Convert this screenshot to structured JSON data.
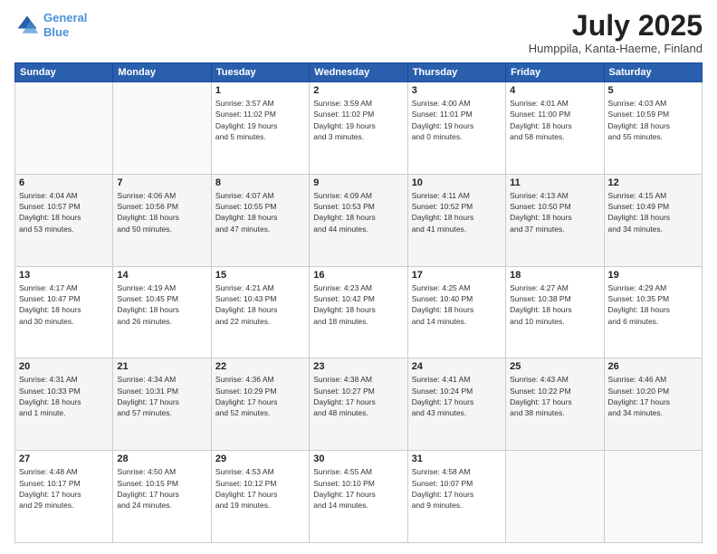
{
  "logo": {
    "line1": "General",
    "line2": "Blue"
  },
  "header": {
    "month": "July 2025",
    "location": "Humppila, Kanta-Haeme, Finland"
  },
  "weekdays": [
    "Sunday",
    "Monday",
    "Tuesday",
    "Wednesday",
    "Thursday",
    "Friday",
    "Saturday"
  ],
  "weeks": [
    [
      {
        "day": "",
        "info": ""
      },
      {
        "day": "",
        "info": ""
      },
      {
        "day": "1",
        "info": "Sunrise: 3:57 AM\nSunset: 11:02 PM\nDaylight: 19 hours\nand 5 minutes."
      },
      {
        "day": "2",
        "info": "Sunrise: 3:59 AM\nSunset: 11:02 PM\nDaylight: 19 hours\nand 3 minutes."
      },
      {
        "day": "3",
        "info": "Sunrise: 4:00 AM\nSunset: 11:01 PM\nDaylight: 19 hours\nand 0 minutes."
      },
      {
        "day": "4",
        "info": "Sunrise: 4:01 AM\nSunset: 11:00 PM\nDaylight: 18 hours\nand 58 minutes."
      },
      {
        "day": "5",
        "info": "Sunrise: 4:03 AM\nSunset: 10:59 PM\nDaylight: 18 hours\nand 55 minutes."
      }
    ],
    [
      {
        "day": "6",
        "info": "Sunrise: 4:04 AM\nSunset: 10:57 PM\nDaylight: 18 hours\nand 53 minutes."
      },
      {
        "day": "7",
        "info": "Sunrise: 4:06 AM\nSunset: 10:56 PM\nDaylight: 18 hours\nand 50 minutes."
      },
      {
        "day": "8",
        "info": "Sunrise: 4:07 AM\nSunset: 10:55 PM\nDaylight: 18 hours\nand 47 minutes."
      },
      {
        "day": "9",
        "info": "Sunrise: 4:09 AM\nSunset: 10:53 PM\nDaylight: 18 hours\nand 44 minutes."
      },
      {
        "day": "10",
        "info": "Sunrise: 4:11 AM\nSunset: 10:52 PM\nDaylight: 18 hours\nand 41 minutes."
      },
      {
        "day": "11",
        "info": "Sunrise: 4:13 AM\nSunset: 10:50 PM\nDaylight: 18 hours\nand 37 minutes."
      },
      {
        "day": "12",
        "info": "Sunrise: 4:15 AM\nSunset: 10:49 PM\nDaylight: 18 hours\nand 34 minutes."
      }
    ],
    [
      {
        "day": "13",
        "info": "Sunrise: 4:17 AM\nSunset: 10:47 PM\nDaylight: 18 hours\nand 30 minutes."
      },
      {
        "day": "14",
        "info": "Sunrise: 4:19 AM\nSunset: 10:45 PM\nDaylight: 18 hours\nand 26 minutes."
      },
      {
        "day": "15",
        "info": "Sunrise: 4:21 AM\nSunset: 10:43 PM\nDaylight: 18 hours\nand 22 minutes."
      },
      {
        "day": "16",
        "info": "Sunrise: 4:23 AM\nSunset: 10:42 PM\nDaylight: 18 hours\nand 18 minutes."
      },
      {
        "day": "17",
        "info": "Sunrise: 4:25 AM\nSunset: 10:40 PM\nDaylight: 18 hours\nand 14 minutes."
      },
      {
        "day": "18",
        "info": "Sunrise: 4:27 AM\nSunset: 10:38 PM\nDaylight: 18 hours\nand 10 minutes."
      },
      {
        "day": "19",
        "info": "Sunrise: 4:29 AM\nSunset: 10:35 PM\nDaylight: 18 hours\nand 6 minutes."
      }
    ],
    [
      {
        "day": "20",
        "info": "Sunrise: 4:31 AM\nSunset: 10:33 PM\nDaylight: 18 hours\nand 1 minute."
      },
      {
        "day": "21",
        "info": "Sunrise: 4:34 AM\nSunset: 10:31 PM\nDaylight: 17 hours\nand 57 minutes."
      },
      {
        "day": "22",
        "info": "Sunrise: 4:36 AM\nSunset: 10:29 PM\nDaylight: 17 hours\nand 52 minutes."
      },
      {
        "day": "23",
        "info": "Sunrise: 4:38 AM\nSunset: 10:27 PM\nDaylight: 17 hours\nand 48 minutes."
      },
      {
        "day": "24",
        "info": "Sunrise: 4:41 AM\nSunset: 10:24 PM\nDaylight: 17 hours\nand 43 minutes."
      },
      {
        "day": "25",
        "info": "Sunrise: 4:43 AM\nSunset: 10:22 PM\nDaylight: 17 hours\nand 38 minutes."
      },
      {
        "day": "26",
        "info": "Sunrise: 4:46 AM\nSunset: 10:20 PM\nDaylight: 17 hours\nand 34 minutes."
      }
    ],
    [
      {
        "day": "27",
        "info": "Sunrise: 4:48 AM\nSunset: 10:17 PM\nDaylight: 17 hours\nand 29 minutes."
      },
      {
        "day": "28",
        "info": "Sunrise: 4:50 AM\nSunset: 10:15 PM\nDaylight: 17 hours\nand 24 minutes."
      },
      {
        "day": "29",
        "info": "Sunrise: 4:53 AM\nSunset: 10:12 PM\nDaylight: 17 hours\nand 19 minutes."
      },
      {
        "day": "30",
        "info": "Sunrise: 4:55 AM\nSunset: 10:10 PM\nDaylight: 17 hours\nand 14 minutes."
      },
      {
        "day": "31",
        "info": "Sunrise: 4:58 AM\nSunset: 10:07 PM\nDaylight: 17 hours\nand 9 minutes."
      },
      {
        "day": "",
        "info": ""
      },
      {
        "day": "",
        "info": ""
      }
    ]
  ]
}
